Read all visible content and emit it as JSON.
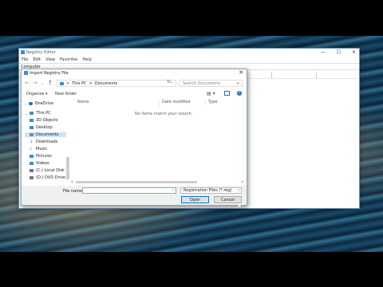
{
  "registry_editor": {
    "title": "Registry Editor",
    "menu": [
      "File",
      "Edit",
      "View",
      "Favorites",
      "Help"
    ],
    "address": "Computer"
  },
  "dialog": {
    "title": "Import Registry File",
    "address": {
      "this_pc": "This PC",
      "sep": ">",
      "folder": "Documents"
    },
    "search_placeholder": "Search Documents",
    "organize_label": "Organize ▾",
    "new_folder_label": "New folder",
    "nav_items": [
      {
        "label": "OneDrive",
        "icon": "cloud-icon",
        "color": "#1e6fd0"
      },
      {
        "label": "This PC",
        "icon": "computer-icon",
        "color": "#3a8fd0"
      },
      {
        "label": "3D Objects",
        "icon": "cube-icon",
        "color": "#3a8fd0"
      },
      {
        "label": "Desktop",
        "icon": "desktop-icon",
        "color": "#3a8fd0"
      },
      {
        "label": "Documents",
        "icon": "document-icon",
        "color": "#8a8a8a"
      },
      {
        "label": "Downloads",
        "icon": "download-icon",
        "color": "#1e6fd0"
      },
      {
        "label": "Music",
        "icon": "music-icon",
        "color": "#1e6fd0"
      },
      {
        "label": "Pictures",
        "icon": "picture-icon",
        "color": "#3a8fd0"
      },
      {
        "label": "Videos",
        "icon": "video-icon",
        "color": "#3a8fd0"
      },
      {
        "label": "(C:) Local Disk",
        "icon": "drive-icon",
        "color": "#777777"
      },
      {
        "label": "(D:) DVD Drive (",
        "icon": "dvd-icon",
        "color": "#777777"
      }
    ],
    "columns": [
      "Name",
      "Date modified",
      "Type"
    ],
    "empty_message": "No items match your search.",
    "file_name_label": "File name:",
    "file_name_value": "",
    "file_type": "Registration Files (*.reg)",
    "open_label": "Open",
    "cancel_label": "Cancel"
  }
}
